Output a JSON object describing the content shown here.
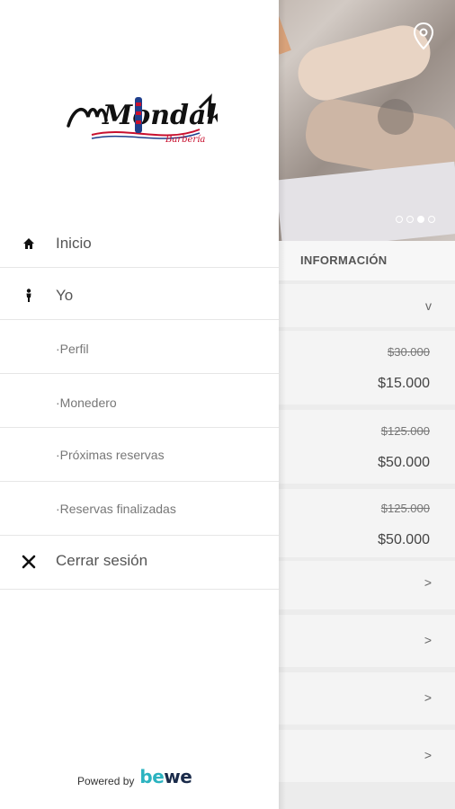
{
  "drawer": {
    "brand": {
      "logo_text": "Mondaka",
      "logo_subtext": "Barbería"
    },
    "menu": [
      {
        "label": "Inicio",
        "icon": "home-icon"
      },
      {
        "label": "Yo",
        "icon": "person-icon"
      },
      {
        "label": "·Perfil"
      },
      {
        "label": "·Monedero"
      },
      {
        "label": "·Próximas reservas"
      },
      {
        "label": "·Reservas finalizadas"
      },
      {
        "label": "Cerrar sesión",
        "icon": "close-icon"
      }
    ],
    "powered_by": {
      "text": "Powered by",
      "brand": "bewe",
      "brand_colors": [
        "#2bb3c0",
        "#1a2b4a"
      ]
    }
  },
  "background": {
    "section_title": "INFORMACIÓN",
    "carousel": {
      "total": 4,
      "active_index": 2
    },
    "services": [
      {
        "old_price": "$30.000",
        "price": "$15.000"
      },
      {
        "old_price": "$125.000",
        "price": "$50.000"
      },
      {
        "old_price": "$125.000",
        "price": "$50.000"
      }
    ],
    "expand_chevron": "v",
    "row_chevron": ">"
  },
  "colors": {
    "overlay": "#ececec",
    "divider": "#e6e6e6",
    "text": "#555555",
    "logo_red": "#c8102e",
    "logo_blue": "#1f3f8c"
  }
}
